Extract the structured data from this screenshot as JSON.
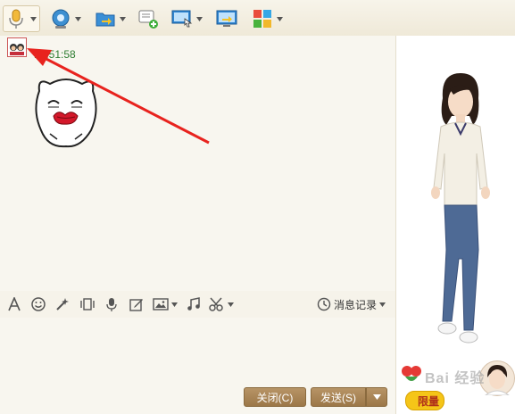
{
  "toolbar": {
    "items": [
      {
        "name": "voice-call",
        "icon": "microphone-icon"
      },
      {
        "name": "video-call",
        "icon": "webcam-icon"
      },
      {
        "name": "file-transfer",
        "icon": "folder-arrow-icon"
      },
      {
        "name": "new-discussion",
        "icon": "chat-plus-icon"
      },
      {
        "name": "remote-assist",
        "icon": "screen-cursor-icon"
      },
      {
        "name": "screen-share",
        "icon": "monitor-share-icon"
      },
      {
        "name": "apps",
        "icon": "grid-apps-icon"
      }
    ]
  },
  "chat": {
    "message_time": "10:51:58",
    "sender_avatar": "avatar-icon",
    "emoticon": "kiss-face-emoticon"
  },
  "input_toolbar": {
    "history_label": "消息记录"
  },
  "actions": {
    "close_label": "关闭(C)",
    "send_label": "发送(S)"
  },
  "right_panel": {
    "limited_label": "限量",
    "watermark": "Bai 经验"
  },
  "colors": {
    "accent": "#a9865a",
    "time_green": "#2e7d32",
    "arrow_red": "#e8231e"
  }
}
